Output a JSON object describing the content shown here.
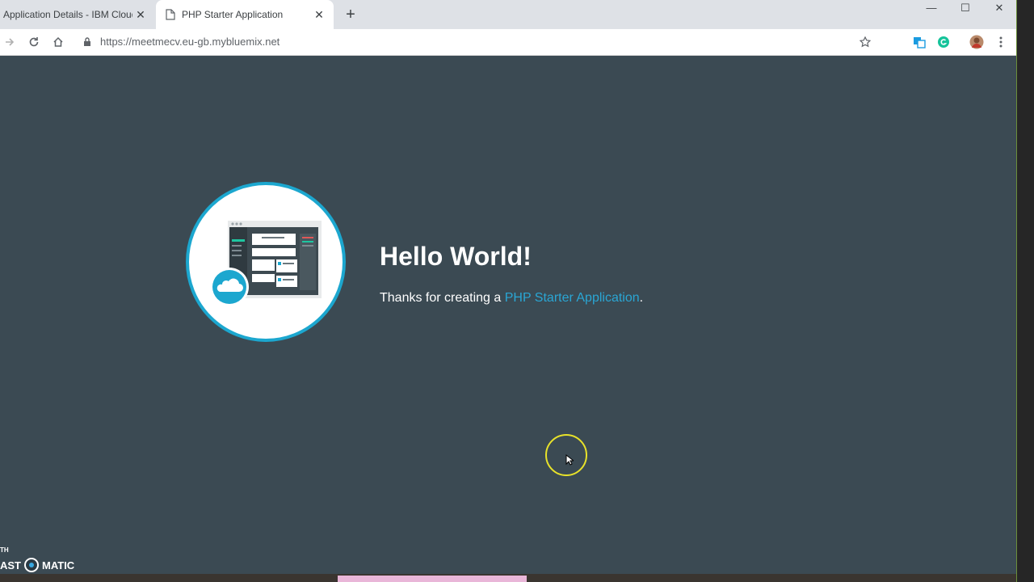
{
  "browser": {
    "tabs": [
      {
        "title": "Application Details - IBM Cloud",
        "active": false
      },
      {
        "title": "PHP Starter Application",
        "active": true
      }
    ],
    "url": "https://meetmecv.eu-gb.mybluemix.net",
    "window_controls": {
      "minimize": "—",
      "maximize": "☐",
      "close": "✕"
    }
  },
  "page": {
    "heading": "Hello World!",
    "thanks_prefix": "Thanks for creating a ",
    "thanks_link": "PHP Starter Application",
    "thanks_suffix": "."
  },
  "watermark": {
    "top": "TH",
    "left": "AST",
    "right": "MATIC"
  },
  "colors": {
    "page_bg": "#3b4a53",
    "accent": "#1ca7cf",
    "link": "#2aa6d4",
    "cursor_ring": "#e8e22a"
  }
}
